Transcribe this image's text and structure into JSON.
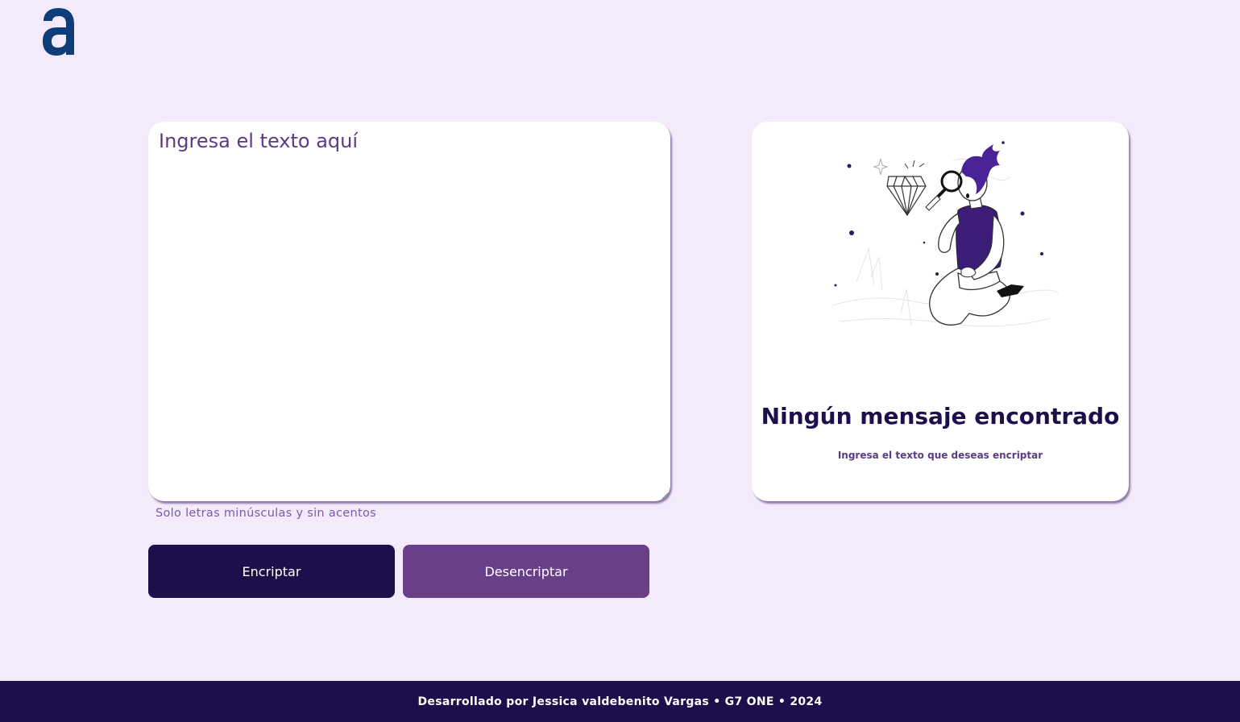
{
  "header": {
    "logo_icon": "alura-a-logo-icon",
    "logo_color": "#0E3D7A"
  },
  "input": {
    "placeholder": "Ingresa el texto aquí",
    "value": ""
  },
  "hint": {
    "text": "Solo letras minúsculas y sin acentos"
  },
  "buttons": {
    "encrypt_label": "Encriptar",
    "decrypt_label": "Desencriptar"
  },
  "output": {
    "illustration_icon": "person-with-magnifying-glass-illustration",
    "empty_title": "Ningún mensaje encontrado",
    "empty_subtitle": "Ingresa el texto que deseas encriptar"
  },
  "footer": {
    "text": "Desarrollado por Jessica valdebenito Vargas • G7 ONE • 2024"
  },
  "colors": {
    "background": "#F3EBFC",
    "primary_dark": "#1D0F4C",
    "secondary_purple": "#6A3F8A",
    "card": "#FFFFFF"
  }
}
